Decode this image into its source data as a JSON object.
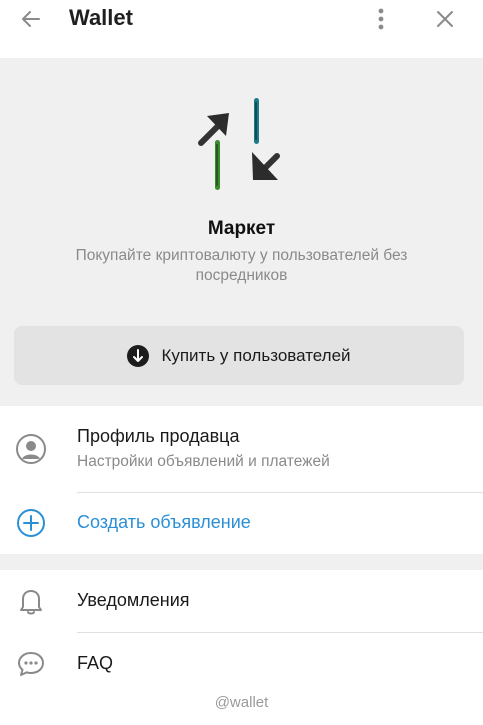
{
  "header": {
    "title": "Wallet",
    "back_icon": "arrow-left-icon",
    "more_icon": "more-vertical-icon",
    "close_icon": "close-icon"
  },
  "hero": {
    "icon": "swap-arrows-icon",
    "title": "Маркет",
    "subtitle": "Покупайте криптовалюту у пользователей без посредников"
  },
  "buy_button": {
    "label": "Купить у пользователей",
    "icon": "arrow-down-circle-icon"
  },
  "menu": {
    "seller_profile": {
      "title": "Профиль продавца",
      "subtitle": "Настройки объявлений и платежей",
      "icon": "user-circle-icon"
    },
    "create_ad": {
      "title": "Создать объявление",
      "icon": "plus-circle-icon",
      "color": "#2b8fd6"
    },
    "notifications": {
      "title": "Уведомления",
      "icon": "bell-icon"
    },
    "faq": {
      "title": "FAQ",
      "icon": "chat-bubble-icon"
    }
  },
  "footer": {
    "handle": "@wallet"
  }
}
